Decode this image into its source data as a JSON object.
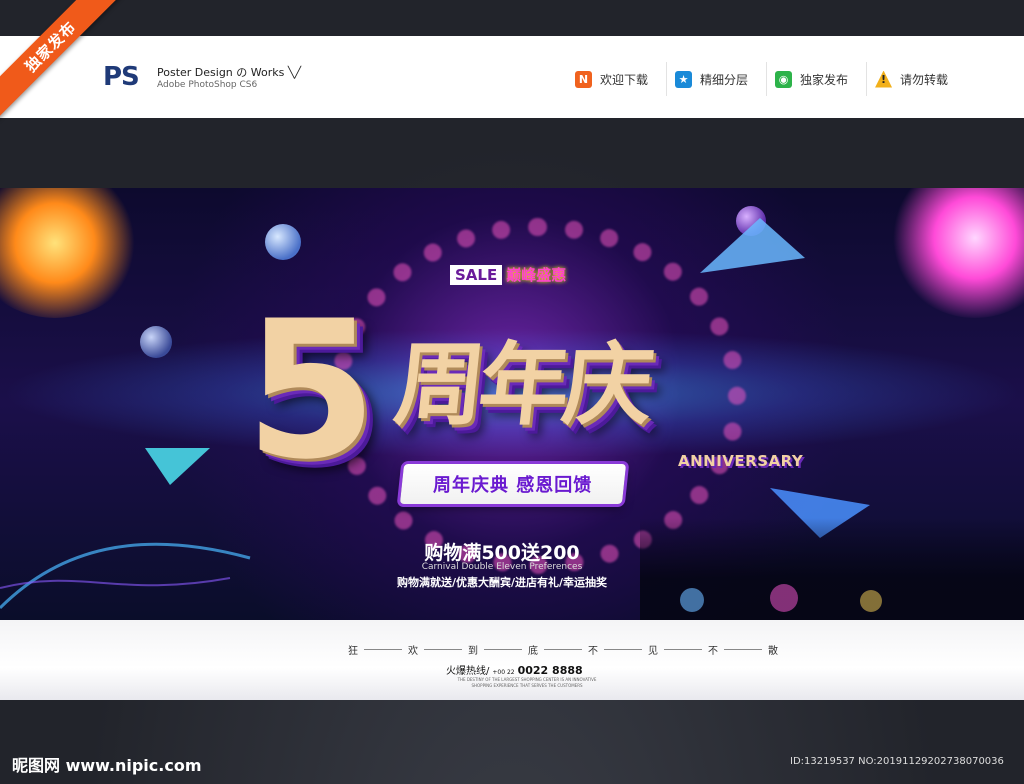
{
  "ribbon": {
    "label": "独家发布"
  },
  "header": {
    "logo": "PS",
    "title": "Poster Design の Works ╲╱",
    "subtitle": "Adobe PhotoShop CS6",
    "links": [
      {
        "icon": "N",
        "label": "欢迎下载",
        "color": "#f0621e"
      },
      {
        "icon": "★",
        "label": "精细分层",
        "color": "#1a8ad8"
      },
      {
        "icon": "◉",
        "label": "独家发布",
        "color": "#2db34a"
      },
      {
        "icon": "!",
        "label": "请勿转载",
        "color": "#f2b01a"
      }
    ]
  },
  "poster": {
    "sale_box": "SALE",
    "sale_text": "巅峰盛惠",
    "title_number": "5",
    "title_cn": "周年庆",
    "anniversary": "ANNIVERSARY",
    "subtitle": "周年庆典 感恩回馈",
    "promo_main": "购物满500送200",
    "promo_en": "Carnival Double Eleven Preferences",
    "promo_sub": "购物满就送/优惠大酬宾/进店有礼/幸运抽奖"
  },
  "bottom": {
    "slogan": [
      "狂",
      "欢",
      "到",
      "底",
      "不",
      "见",
      "不",
      "散"
    ],
    "hotline_label": "火爆热线/",
    "hotline_prefix": "+00 22",
    "hotline_number": "0022 8888",
    "fine_print": "THE DESTINY OF THE LARGEST SHOPPING CENTER IS AN INNOVATIVE SHOPPING EXPERIENCE THAT SERVES THE CUSTOMERS"
  },
  "watermark": {
    "site": "昵图网 www.nipic.com",
    "id": "ID:13219537 NO:20191129202738070036"
  }
}
